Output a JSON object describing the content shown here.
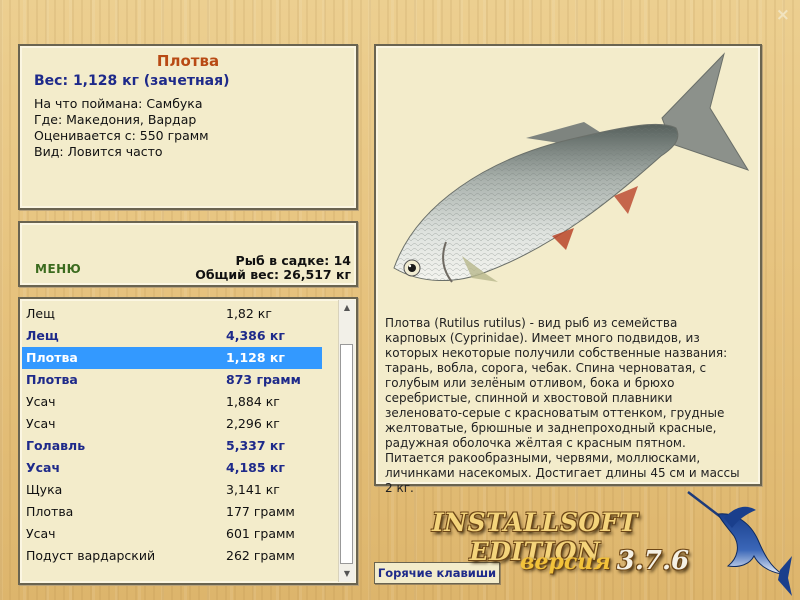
{
  "info": {
    "title": "Плотва",
    "weight": "Вес: 1,128 кг (зачетная)",
    "bait": "На что поймана: Самбука",
    "location": "Где: Македония, Вардар",
    "estimate": "Оценивается с: 550 грамм",
    "kind": "Вид: Ловится часто"
  },
  "stats": {
    "menu_label": "МЕНЮ",
    "fish_count": "Рыб в садке: 14",
    "total_weight": "Общий вес: 26,517 кг"
  },
  "catch_list": [
    {
      "name": "Лещ",
      "weight": "1,82 кг",
      "style": "normal"
    },
    {
      "name": "Лещ",
      "weight": "4,386 кг",
      "style": "bold"
    },
    {
      "name": "Плотва",
      "weight": "1,128 кг",
      "style": "selected"
    },
    {
      "name": "Плотва",
      "weight": "873 грамм",
      "style": "bold"
    },
    {
      "name": "Усач",
      "weight": "1,884 кг",
      "style": "normal"
    },
    {
      "name": "Усач",
      "weight": "2,296 кг",
      "style": "normal"
    },
    {
      "name": "Голавль",
      "weight": "5,337 кг",
      "style": "bold"
    },
    {
      "name": "Усач",
      "weight": "4,185 кг",
      "style": "bold"
    },
    {
      "name": "Щука",
      "weight": "3,141 кг",
      "style": "normal"
    },
    {
      "name": "Плотва",
      "weight": "177 грамм",
      "style": "normal"
    },
    {
      "name": "Усач",
      "weight": "601 грамм",
      "style": "normal"
    },
    {
      "name": "Подуст вардарский",
      "weight": "262 грамм",
      "style": "normal"
    }
  ],
  "description": "Плотва (Rutilus rutilus) - вид рыб из семейства карповых (Cyprinidae). Имеет много подвидов, из которых некоторые получили собственные названия: тарань, вобла, сорога, чебак. Спина черноватая, с голубым или зелёным отливом, бока и брюхо серебристые, спинной и хвостовой плавники зеленовато-серые с красноватым оттенком, грудные желтоватые, брюшные и заднепроходный красные, радужная оболочка жёлтая с красным пятном. Питается ракообразными, червями, моллюсками, личинками насекомых. Достигает длины 45 см и массы 2 кг.",
  "hotkeys_label": "Горячие клавиши",
  "close_label": "×",
  "brand": {
    "edition": "INSTALLSOFT EDITION",
    "version_label": "версия",
    "version": "3.7.6"
  },
  "colors": {
    "selection": "#3399ff",
    "bold_text": "#1e2a8a",
    "title": "#b84a14",
    "menu": "#3b6b1e"
  },
  "icons": [
    "close-icon",
    "fish-image",
    "marlin-logo-icon",
    "scroll-up-icon",
    "scroll-down-icon"
  ]
}
